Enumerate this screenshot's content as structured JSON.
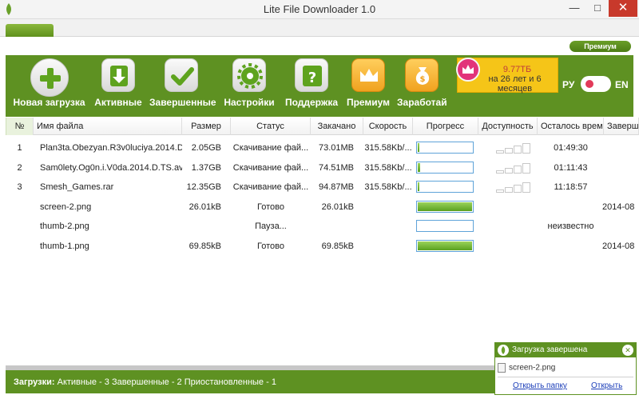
{
  "window": {
    "title": "Lite File Downloader 1.0",
    "min_glyph": "—",
    "max_glyph": "□",
    "close_glyph": "✕"
  },
  "premium_button": "Премиум",
  "toolbar": {
    "items": [
      {
        "label": "Новая загрузка",
        "icon": "plus-icon"
      },
      {
        "label": "Активные",
        "icon": "download-arrow-icon"
      },
      {
        "label": "Завершенные",
        "icon": "checkmark-icon"
      },
      {
        "label": "Настройки",
        "icon": "gear-icon"
      },
      {
        "label": "Поддержка",
        "icon": "question-icon"
      },
      {
        "label": "Премиум",
        "icon": "crown-icon"
      },
      {
        "label": "Заработай",
        "icon": "money-bag-icon"
      }
    ],
    "promo": {
      "amount": "9.77ТБ",
      "duration": "на 26 лет и 6 месяцев"
    },
    "lang": {
      "left": "РУ",
      "right": "EN"
    }
  },
  "table": {
    "columns": [
      "№",
      "Имя файла",
      "Размер",
      "Статус",
      "Закачано",
      "Скорость",
      "Прогресс",
      "Доступность",
      "Осталось времени",
      "Заверш..."
    ],
    "rows": [
      {
        "num": "1",
        "name": "Plan3ta.Obezyan.R3v0luciya.2014.D...",
        "size": "2.05GB",
        "status": "Скачивание фай...",
        "downloaded": "73.01MB",
        "speed": "315.58Kb/...",
        "progress": 0.03,
        "avail": 1,
        "remaining": "01:49:30",
        "completed": ""
      },
      {
        "num": "2",
        "name": "Sam0lety.Og0n.i.V0da.2014.D.TS.avi",
        "size": "1.37GB",
        "status": "Скачивание фай...",
        "downloaded": "74.51MB",
        "speed": "315.58Kb/...",
        "progress": 0.05,
        "avail": 1,
        "remaining": "01:11:43",
        "completed": ""
      },
      {
        "num": "3",
        "name": "Smesh_Games.rar",
        "size": "12.35GB",
        "status": "Скачивание фай...",
        "downloaded": "94.87MB",
        "speed": "315.58Kb/...",
        "progress": 0.01,
        "avail": 1,
        "remaining": "11:18:57",
        "completed": ""
      },
      {
        "num": "",
        "name": "screen-2.png",
        "size": "26.01kB",
        "status": "Готово",
        "downloaded": "26.01kB",
        "speed": "",
        "progress": 1.0,
        "avail": 0,
        "remaining": "",
        "completed": "2014-08"
      },
      {
        "num": "",
        "name": "thumb-2.png",
        "size": "",
        "status": "Пауза...",
        "downloaded": "",
        "speed": "",
        "progress": 0.0,
        "avail": 0,
        "remaining": "неизвестно",
        "completed": ""
      },
      {
        "num": "",
        "name": "thumb-1.png",
        "size": "69.85kB",
        "status": "Готово",
        "downloaded": "69.85kB",
        "speed": "",
        "progress": 1.0,
        "avail": 0,
        "remaining": "",
        "completed": "2014-08"
      }
    ]
  },
  "statusbar": {
    "label": "Загрузки:",
    "text": " Активные - 3 Завершенные - 2 Приостановленные - 1"
  },
  "notification": {
    "title": "Загрузка завершена",
    "file": "screen-2.png",
    "open_folder": "Открыть папку",
    "open": "Открыть"
  }
}
